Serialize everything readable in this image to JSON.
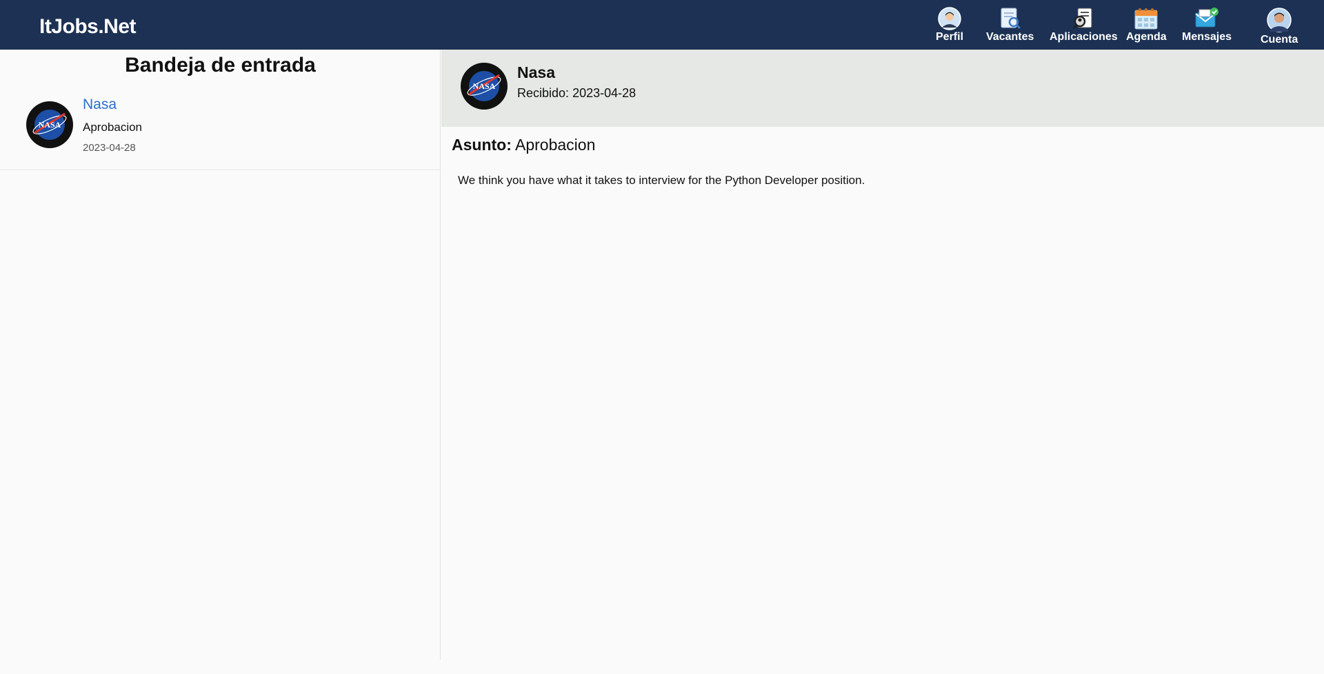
{
  "header": {
    "brand": "ItJobs.Net",
    "nav": [
      {
        "label": "Perfil",
        "icon": "profile-icon"
      },
      {
        "label": "Vacantes",
        "icon": "vacancies-search-icon"
      },
      {
        "label": "Aplicaciones",
        "icon": "applications-icon"
      },
      {
        "label": "Agenda",
        "icon": "calendar-icon"
      },
      {
        "label": "Mensajes",
        "icon": "mail-icon"
      },
      {
        "label": "Cuenta",
        "icon": "account-avatar-icon"
      }
    ]
  },
  "inbox": {
    "title": "Bandeja de entrada",
    "messages": [
      {
        "sender": "Nasa",
        "subject": "Aprobacion",
        "date": "2023-04-28",
        "avatar": "nasa-logo-icon"
      }
    ]
  },
  "detail": {
    "sender": "Nasa",
    "received_label": "Recibido:",
    "received_date": "2023-04-28",
    "subject_label": "Asunto:",
    "subject": "Aprobacion",
    "body": "We think you have what it takes to interview for the Python Developer position."
  },
  "colors": {
    "header_bg": "#1c3153",
    "link": "#2a6fc9",
    "detail_header_bg": "#e6e8e5"
  }
}
